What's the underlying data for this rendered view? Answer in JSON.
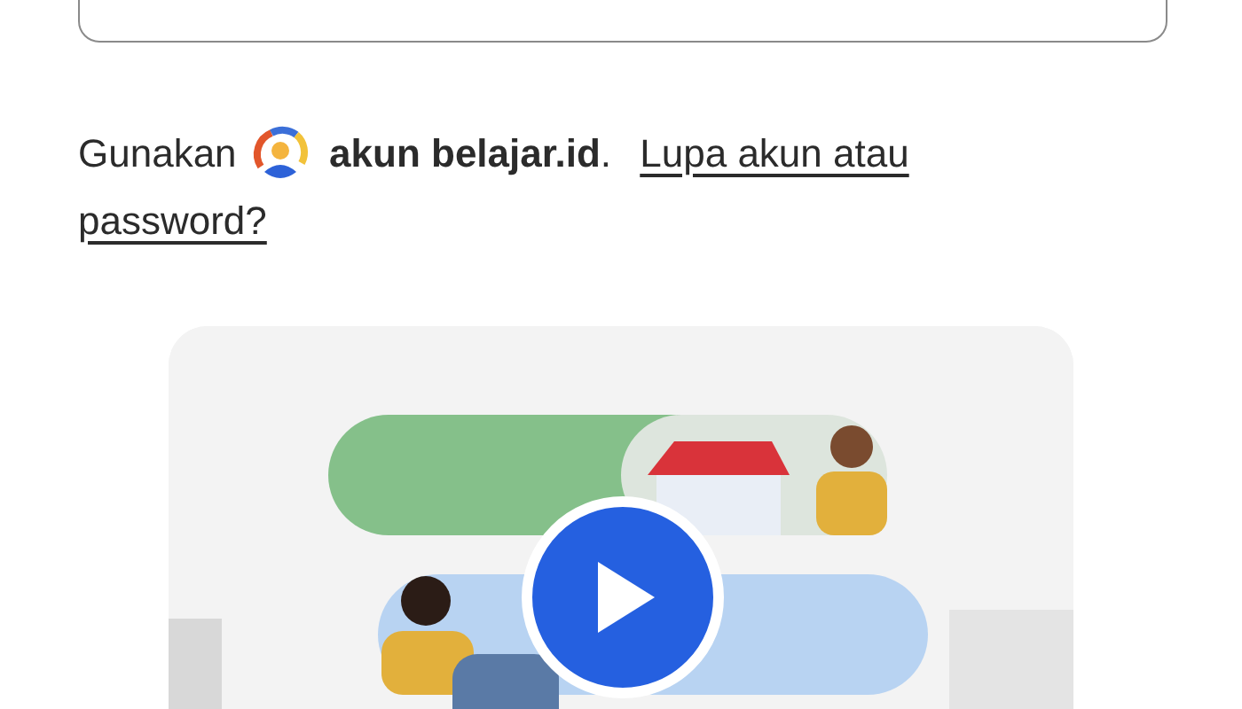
{
  "login_hint": {
    "prefix": "Gunakan",
    "account": "**akun belajar.id**.",
    "link_lines": [
      "Lupa akun atau",
      "password?"
    ]
  }
}
